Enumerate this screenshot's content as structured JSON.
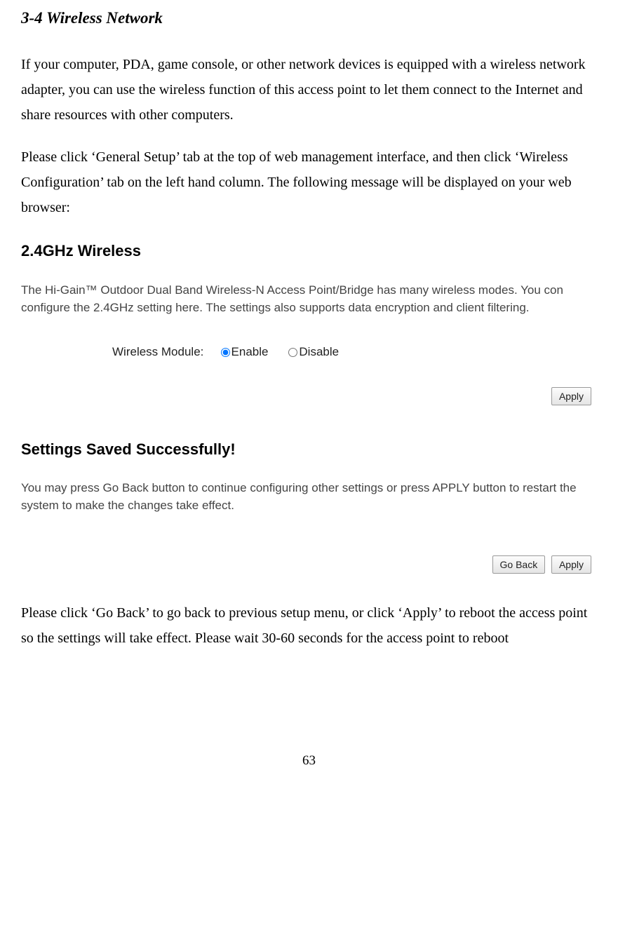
{
  "section_title": "3-4 Wireless Network",
  "paragraph1": "If your computer, PDA, game console, or other network devices is equipped with a wireless network adapter, you can use the wireless function of this access point to let them connect to the Internet and share resources with other computers.",
  "paragraph2": "Please click ‘General Setup’ tab at the top of web management interface, and then click ‘Wireless Configuration’ tab on the left hand column. The following message will be displayed on your web browser:",
  "screenshot1": {
    "heading": "2.4GHz Wireless",
    "description": "The Hi-Gain™ Outdoor Dual Band Wireless-N Access Point/Bridge has many wireless modes. You con configure the 2.4GHz setting here. The settings also supports data encryption and client filtering.",
    "wireless_module_label": "Wireless Module:",
    "option_enable": "Enable",
    "option_disable": "Disable",
    "apply_label": "Apply"
  },
  "screenshot2": {
    "heading": "Settings Saved Successfully!",
    "description": "You may press Go Back button to continue configuring other settings or press APPLY button to restart the system to make the changes take effect.",
    "go_back_label": "Go Back",
    "apply_label": "Apply"
  },
  "paragraph3": "Please click ‘Go Back’ to go back to previous setup menu, or click ‘Apply’ to reboot the access point so the settings will take effect. Please wait 30-60 seconds for the access point to reboot",
  "page_number": "63"
}
